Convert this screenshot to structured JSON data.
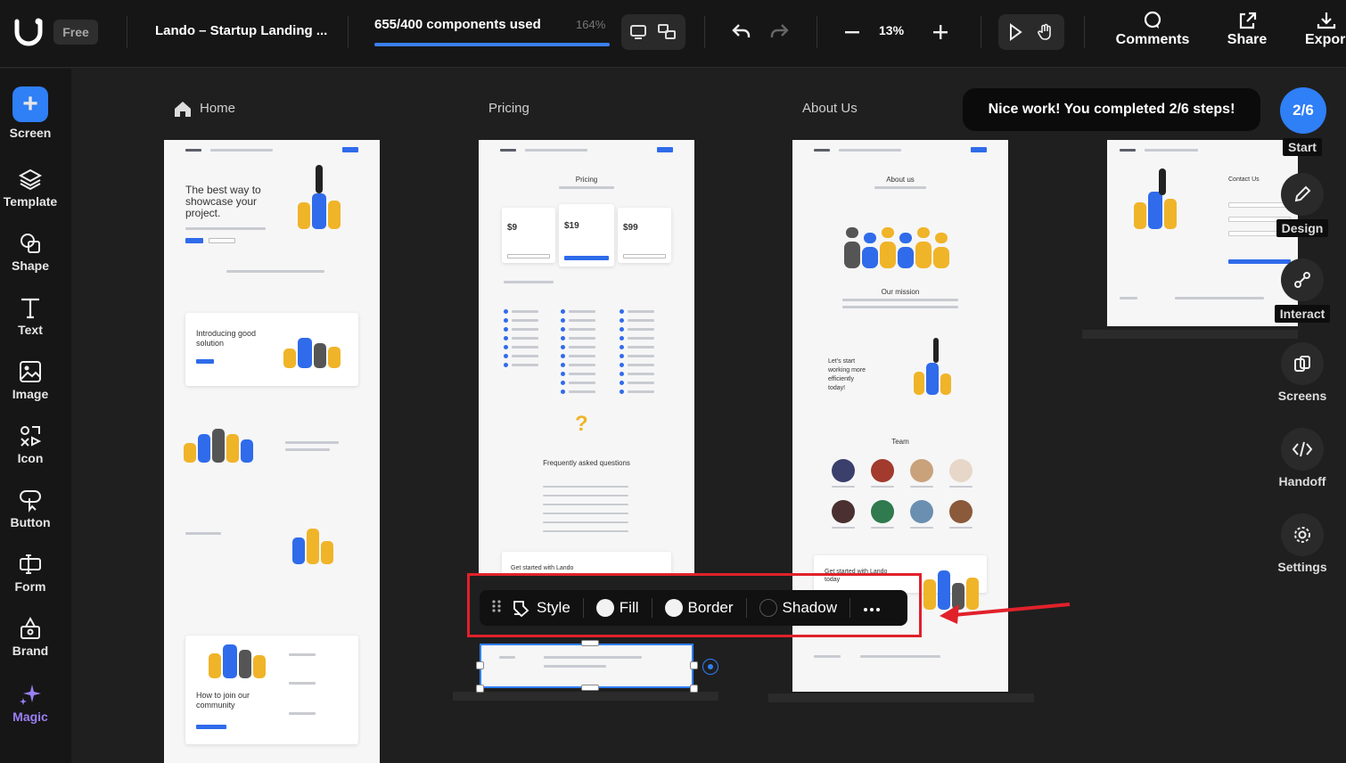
{
  "app": {
    "plan_badge": "Free",
    "project_title": "Lando – Startup Landing ...",
    "usage_label": "655/400 components used",
    "usage_percent": "164%",
    "usage_fill": 1.0,
    "zoom": "13%",
    "accent_color": "#2f7ff6"
  },
  "top_actions": [
    {
      "label": "Comments",
      "icon": "comment-icon"
    },
    {
      "label": "Share",
      "icon": "share-icon"
    },
    {
      "label": "Expor",
      "icon": "download-icon"
    }
  ],
  "left_tools": [
    {
      "label": "Screen",
      "icon": "plus-icon"
    },
    {
      "label": "Template",
      "icon": "layers-icon"
    },
    {
      "label": "Shape",
      "icon": "shape-icon"
    },
    {
      "label": "Text",
      "icon": "text-icon"
    },
    {
      "label": "Image",
      "icon": "image-icon"
    },
    {
      "label": "Icon",
      "icon": "icon-grid-icon"
    },
    {
      "label": "Button",
      "icon": "button-icon"
    },
    {
      "label": "Form",
      "icon": "form-icon"
    },
    {
      "label": "Brand",
      "icon": "brand-icon"
    },
    {
      "label": "Magic",
      "icon": "sparkle-icon"
    }
  ],
  "pages": [
    {
      "label": "Home"
    },
    {
      "label": "Pricing"
    },
    {
      "label": "About Us"
    }
  ],
  "home_frame": {
    "hero_title": "The best way to showcase your project.",
    "section1": "Introducing good solution",
    "section4": "How to join our community"
  },
  "pricing_frame": {
    "title": "Pricing",
    "prices": [
      "$9",
      "$19",
      "$99"
    ],
    "faq_title": "Frequently asked questions",
    "cta": "Get started with Lando today"
  },
  "about_frame": {
    "title": "About us",
    "mission": "Our mission",
    "working": "Let's start working more efficiently today!",
    "team": "Team",
    "cta": "Get started with Lando today"
  },
  "contact_frame": {
    "title": "Contact Us"
  },
  "steps": {
    "toast": "Nice work! You completed 2/6 steps!",
    "counter": "2/6"
  },
  "right_tools": [
    {
      "label": "Start",
      "icon": "start-icon"
    },
    {
      "label": "Design",
      "icon": "pencil-icon"
    },
    {
      "label": "Interact",
      "icon": "link-icon"
    },
    {
      "label": "Screens",
      "icon": "screens-icon"
    },
    {
      "label": "Handoff",
      "icon": "code-icon"
    },
    {
      "label": "Settings",
      "icon": "gear-icon"
    }
  ],
  "style_toolbar": {
    "style": "Style",
    "fill": "Fill",
    "border": "Border",
    "shadow": "Shadow"
  }
}
